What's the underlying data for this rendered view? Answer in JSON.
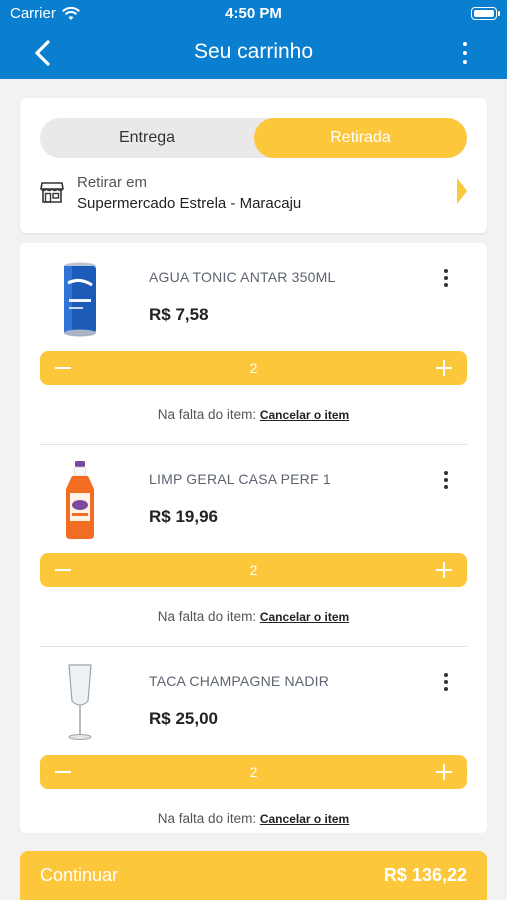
{
  "status": {
    "carrier": "Carrier",
    "time": "4:50 PM"
  },
  "header": {
    "title": "Seu carrinho"
  },
  "delivery": {
    "options": [
      "Entrega",
      "Retirada"
    ],
    "selected": "Retirada",
    "pickup_label": "Retirar em",
    "pickup_store": "Supermercado Estrela - Maracaju"
  },
  "items": [
    {
      "name": "AGUA TONIC ANTAR 350ML",
      "price": "R$ 7,58",
      "quantity": "2",
      "missing_label": "Na falta do item:",
      "missing_action": "Cancelar o item",
      "image": "blue-soda-can"
    },
    {
      "name": "LIMP GERAL CASA PERF 1",
      "price": "R$ 19,96",
      "quantity": "2",
      "missing_label": "Na falta do item:",
      "missing_action": "Cancelar o item",
      "image": "orange-cleaner-bottle"
    },
    {
      "name": "TACA CHAMPAGNE NADIR",
      "price": "R$ 25,00",
      "quantity": "2",
      "missing_label": "Na falta do item:",
      "missing_action": "Cancelar o item",
      "image": "champagne-glass"
    }
  ],
  "footer": {
    "continue_label": "Continuar",
    "total": "R$ 136,22"
  },
  "colors": {
    "primary": "#0a7fd0",
    "accent": "#fdc73b"
  }
}
